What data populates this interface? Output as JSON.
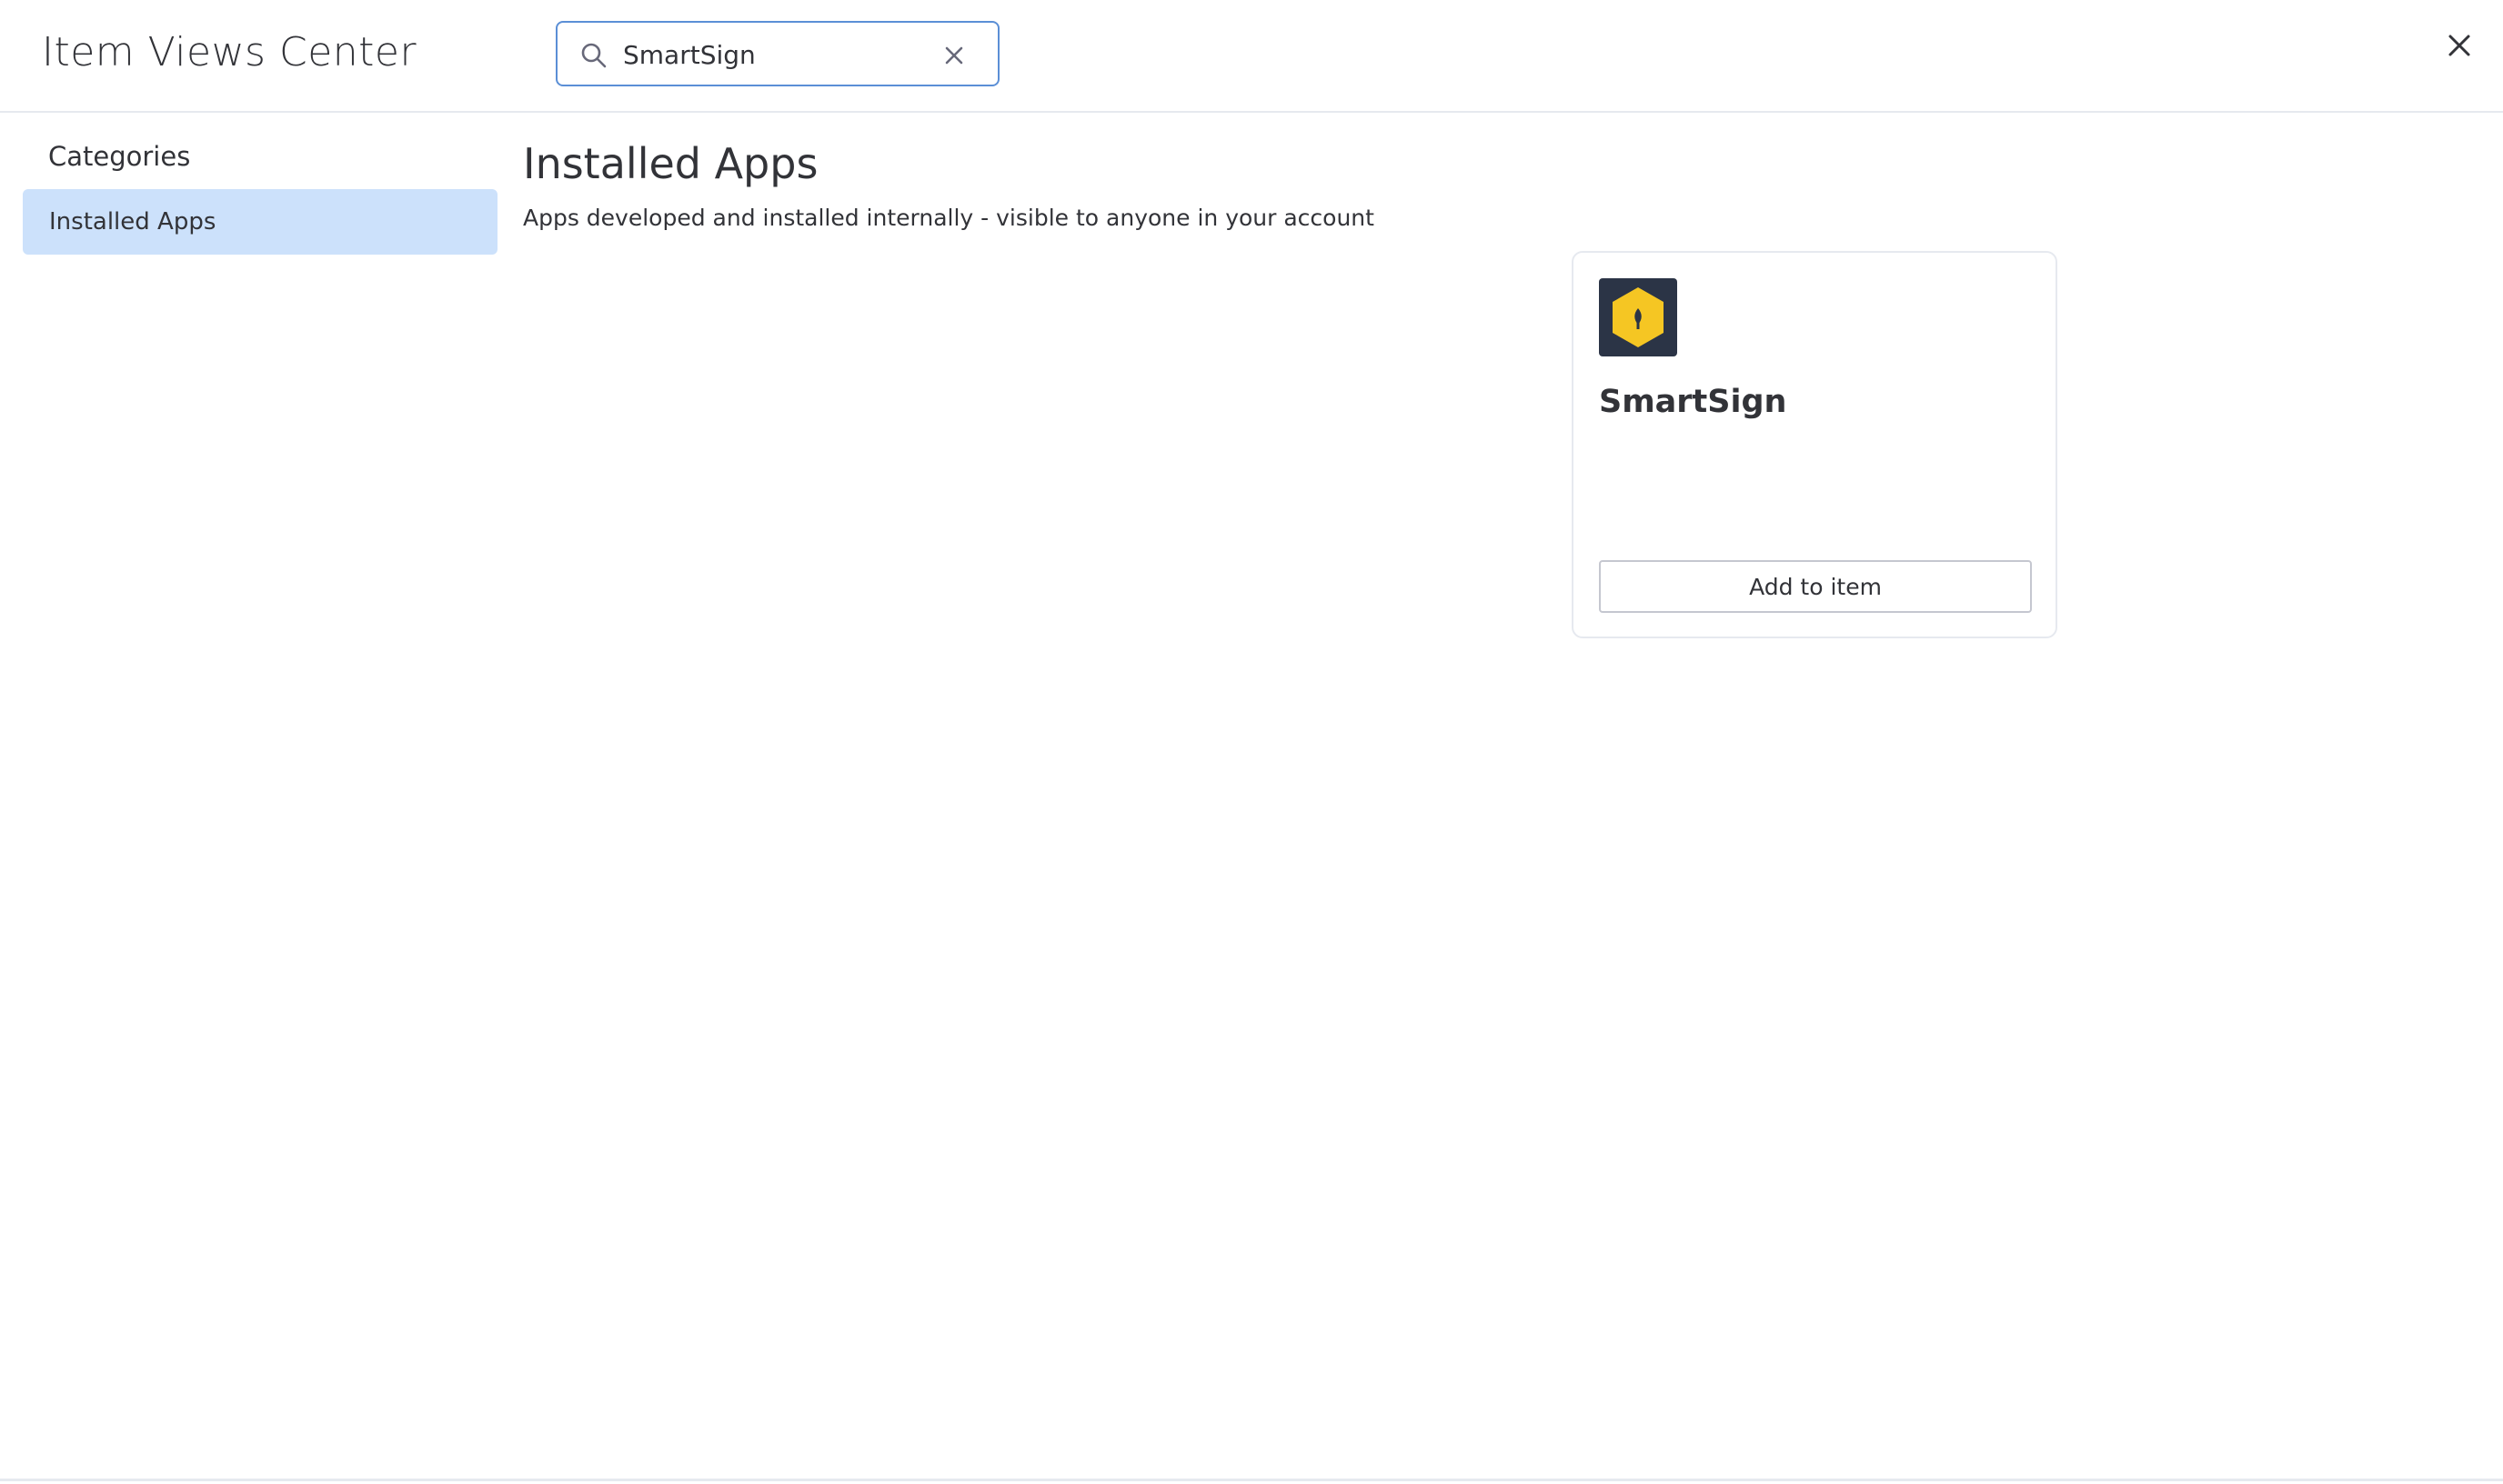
{
  "header": {
    "title": "Item Views Center",
    "search": {
      "value": "SmartSign",
      "placeholder": ""
    }
  },
  "sidebar": {
    "heading": "Categories",
    "items": [
      {
        "label": "Installed Apps",
        "selected": true
      }
    ]
  },
  "main": {
    "title": "Installed Apps",
    "subtitle": "Apps developed and installed internally - visible to anyone in your account",
    "apps": [
      {
        "name": "SmartSign",
        "icon": "smartsign-logo-icon",
        "button_label": "Add to item"
      }
    ]
  },
  "colors": {
    "selected_bg": "#cce1fb",
    "search_border": "#5b8fd6",
    "logo_bg": "#2b3446",
    "logo_hexagon": "#f5c623",
    "text": "#323338",
    "divider": "#e6e9ef"
  }
}
